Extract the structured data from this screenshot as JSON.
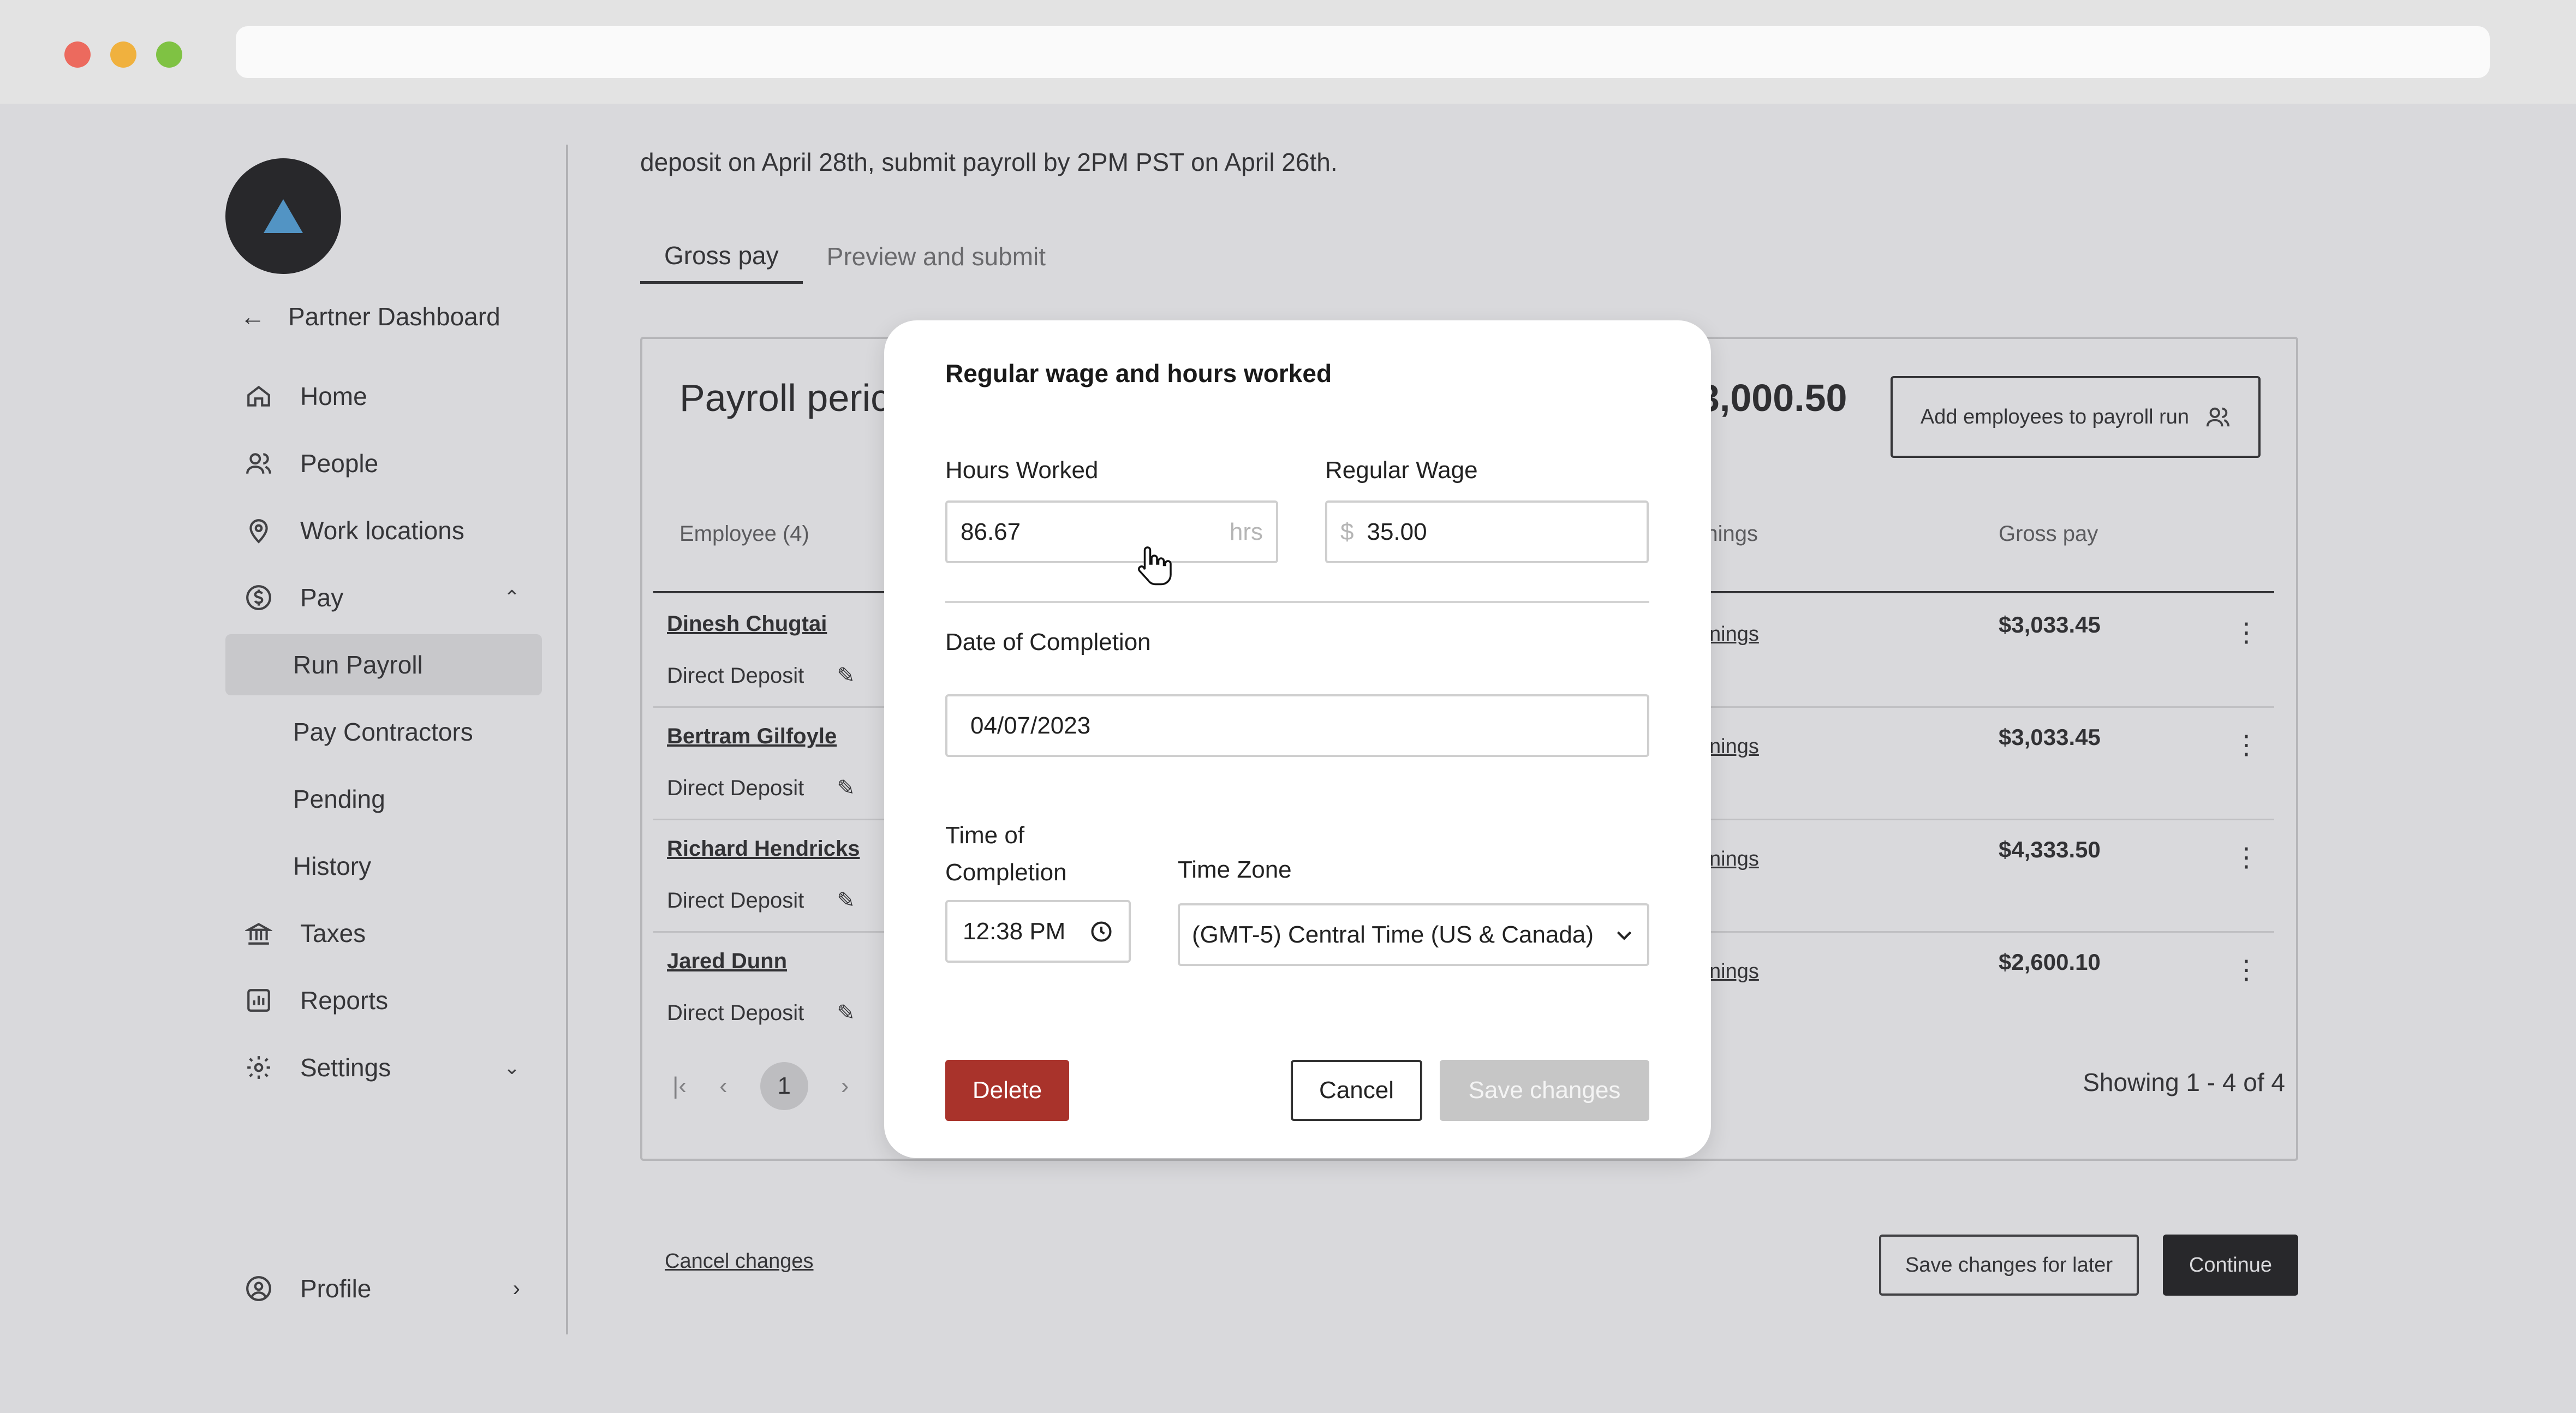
{
  "browser": {
    "url": ""
  },
  "sidebar": {
    "back_label": "Partner Dashboard",
    "items": [
      {
        "label": "Home",
        "icon": "home-icon"
      },
      {
        "label": "People",
        "icon": "people-icon"
      },
      {
        "label": "Work locations",
        "icon": "location-pin-icon"
      },
      {
        "label": "Pay",
        "icon": "dollar-circle-icon",
        "expanded": true
      },
      {
        "label": "Run Payroll",
        "active": true
      },
      {
        "label": "Pay Contractors"
      },
      {
        "label": "Pending"
      },
      {
        "label": "History"
      },
      {
        "label": "Taxes",
        "icon": "bank-icon"
      },
      {
        "label": "Reports",
        "icon": "chart-icon"
      },
      {
        "label": "Settings",
        "icon": "gear-icon"
      }
    ],
    "profile_label": "Profile"
  },
  "main": {
    "deposit_text": "deposit on April 28th, submit payroll by 2PM PST on April 26th.",
    "tabs": [
      {
        "label": "Gross pay",
        "active": true
      },
      {
        "label": "Preview and submit"
      }
    ],
    "card": {
      "title": "Payroll peric",
      "total": "3,000.50",
      "add_button": "Add employees to payroll run",
      "headers": {
        "employee": "Employee (4)",
        "earnings": "rnings",
        "gross": "Gross pay"
      },
      "rows": [
        {
          "name": "Dinesh Chugtai",
          "method": "Direct Deposit",
          "earnings_link": "nings",
          "gross": "$3,033.45"
        },
        {
          "name": "Bertram Gilfoyle",
          "method": "Direct Deposit",
          "earnings_link": "nings",
          "gross": "$3,033.45"
        },
        {
          "name": "Richard Hendricks",
          "method": "Direct Deposit",
          "earnings_link": "nings",
          "gross": "$4,333.50"
        },
        {
          "name": "Jared Dunn",
          "method": "Direct Deposit",
          "earnings_link": "nings",
          "gross": "$2,600.10"
        }
      ],
      "page": "1",
      "showing": "Showing 1 - 4 of 4"
    },
    "cancel_changes": "Cancel changes",
    "save_later": "Save changes for later",
    "continue": "Continue"
  },
  "modal": {
    "title": "Regular wage and hours worked",
    "hours_label": "Hours Worked",
    "hours_value": "86.67",
    "hours_suffix": "hrs",
    "wage_label": "Regular Wage",
    "wage_prefix": "$",
    "wage_value": "35.00",
    "date_label": "Date of Completion",
    "date_value": "04/07/2023",
    "time_label_1": "Time of",
    "time_label_2": "Completion",
    "time_value": "12:38 PM",
    "tz_label": "Time Zone",
    "tz_value": "(GMT-5) Central Time (US & Canada)",
    "delete": "Delete",
    "cancel": "Cancel",
    "save": "Save changes"
  },
  "colors": {
    "delete": "#a9332b",
    "logo_accent": "#4aa3df",
    "continue": "#111111"
  }
}
